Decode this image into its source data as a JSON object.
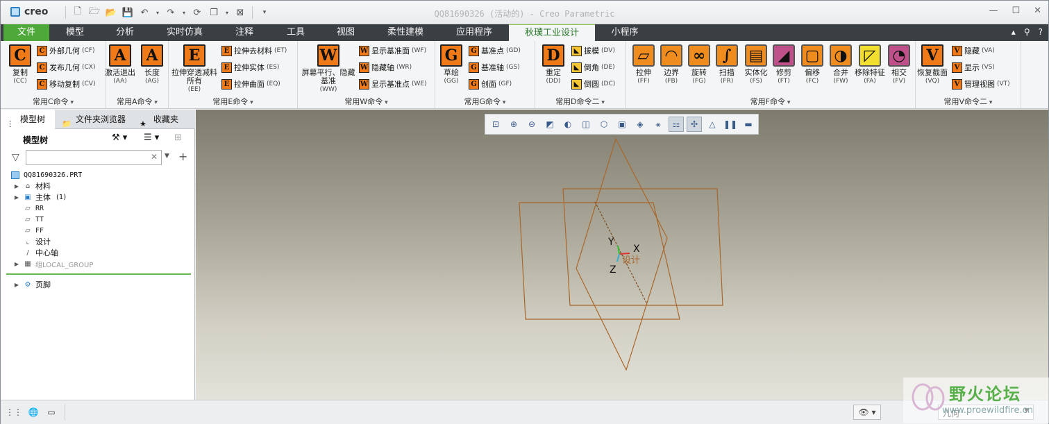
{
  "app": {
    "logo": "creo",
    "title": "QQ81690326 (活动的) - Creo Parametric",
    "minimize": "—",
    "maximize": "☐",
    "close": "✕"
  },
  "tabs": [
    {
      "label": "文件"
    },
    {
      "label": "模型"
    },
    {
      "label": "分析"
    },
    {
      "label": "实时仿真"
    },
    {
      "label": "注释"
    },
    {
      "label": "工具"
    },
    {
      "label": "视图"
    },
    {
      "label": "柔性建模"
    },
    {
      "label": "应用程序"
    },
    {
      "label": "秋璞工业设计"
    },
    {
      "label": "小程序"
    }
  ],
  "ribbon": {
    "c": {
      "label": "常用C命令",
      "big": {
        "glyph": "C",
        "label": "复制",
        "code": "(CC)"
      },
      "items": [
        {
          "glyph": "C",
          "label": "外部几何",
          "code": "(CF)"
        },
        {
          "glyph": "C",
          "label": "发布几何",
          "code": "(CX)"
        },
        {
          "glyph": "C",
          "label": "移动复制",
          "code": "(CV)"
        }
      ]
    },
    "a": {
      "label": "常用A命令",
      "b1": {
        "glyph": "A",
        "label": "激活退出",
        "code": "(AA)"
      },
      "b2": {
        "glyph": "A",
        "label": "长度",
        "code": "(AG)"
      }
    },
    "e": {
      "label": "常用E命令",
      "big": {
        "glyph": "E",
        "label": "拉伸穿透减料所有",
        "code": "(EE)"
      },
      "items": [
        {
          "glyph": "E",
          "label": "拉伸去材料",
          "code": "(ET)"
        },
        {
          "glyph": "E",
          "label": "拉伸实体",
          "code": "(ES)"
        },
        {
          "glyph": "E",
          "label": "拉伸曲面",
          "code": "(EQ)"
        }
      ]
    },
    "w": {
      "label": "常用W命令",
      "big": {
        "glyph": "W",
        "label": "屏幕平行、隐藏基准",
        "code": "(WW)"
      },
      "items": [
        {
          "glyph": "W",
          "label": "显示基准面",
          "code": "(WF)"
        },
        {
          "glyph": "W",
          "label": "隐藏轴",
          "code": "(WR)"
        },
        {
          "glyph": "W",
          "label": "显示基准点",
          "code": "(WE)"
        }
      ]
    },
    "g": {
      "label": "常用G命令",
      "big": {
        "glyph": "G",
        "label": "草绘",
        "code": "(GG)"
      },
      "items": [
        {
          "glyph": "G",
          "label": "基准点",
          "code": "(GD)"
        },
        {
          "glyph": "G",
          "label": "基准轴",
          "code": "(GS)"
        },
        {
          "glyph": "G",
          "label": "创面",
          "code": "(GF)"
        }
      ]
    },
    "d": {
      "label": "常用D命令二",
      "big": {
        "glyph": "D",
        "label": "重定",
        "code": "(DD)"
      },
      "items": [
        {
          "glyph": "◣",
          "label": "拔模",
          "code": "(DV)"
        },
        {
          "glyph": "◣",
          "label": "倒角",
          "code": "(DE)"
        },
        {
          "glyph": "◣",
          "label": "倒圆",
          "code": "(DC)"
        }
      ]
    },
    "f": {
      "label": "常用F命令",
      "items": [
        {
          "label": "拉伸",
          "code": "(FF)"
        },
        {
          "label": "边界",
          "code": "(FB)"
        },
        {
          "label": "旋转",
          "code": "(FG)"
        },
        {
          "label": "扫描",
          "code": "(FR)"
        },
        {
          "label": "实体化",
          "code": "(FS)"
        },
        {
          "label": "修剪",
          "code": "(FT)"
        },
        {
          "label": "偏移",
          "code": "(FC)"
        },
        {
          "label": "合并",
          "code": "(FW)"
        },
        {
          "label": "移除特征",
          "code": "(FA)"
        },
        {
          "label": "相交",
          "code": "(FV)"
        }
      ]
    },
    "v": {
      "label": "常用V命令二",
      "big": {
        "glyph": "V",
        "label": "恢复截面",
        "code": "(VQ)"
      },
      "items": [
        {
          "glyph": "V",
          "label": "隐藏",
          "code": "(VA)"
        },
        {
          "glyph": "V",
          "label": "显示",
          "code": "(VS)"
        },
        {
          "glyph": "V",
          "label": "管理视图",
          "code": "(VT)"
        }
      ]
    }
  },
  "tree": {
    "tabs": [
      {
        "label": "模型树"
      },
      {
        "label": "文件夹浏览器"
      },
      {
        "label": "收藏夹"
      }
    ],
    "title": "模型树",
    "filter_value": "",
    "nodes": [
      {
        "label": "QQ81690326.PRT"
      },
      {
        "label": "材料"
      },
      {
        "label": "主体",
        "count": "(1)"
      },
      {
        "label": "RR"
      },
      {
        "label": "TT"
      },
      {
        "label": "FF"
      },
      {
        "label": "设计"
      },
      {
        "label": "中心轴"
      },
      {
        "label": "组LOCAL_GROUP"
      },
      {
        "label": "页脚"
      }
    ]
  },
  "canvas": {
    "axis_x": "X",
    "axis_y": "Y",
    "axis_z": "Z",
    "csys": "设计",
    "plane_color": "#b0621f"
  },
  "status": {
    "filter_value": "几何"
  },
  "watermark": {
    "title": "野火论坛",
    "url": "www.proewildfire.cn"
  }
}
